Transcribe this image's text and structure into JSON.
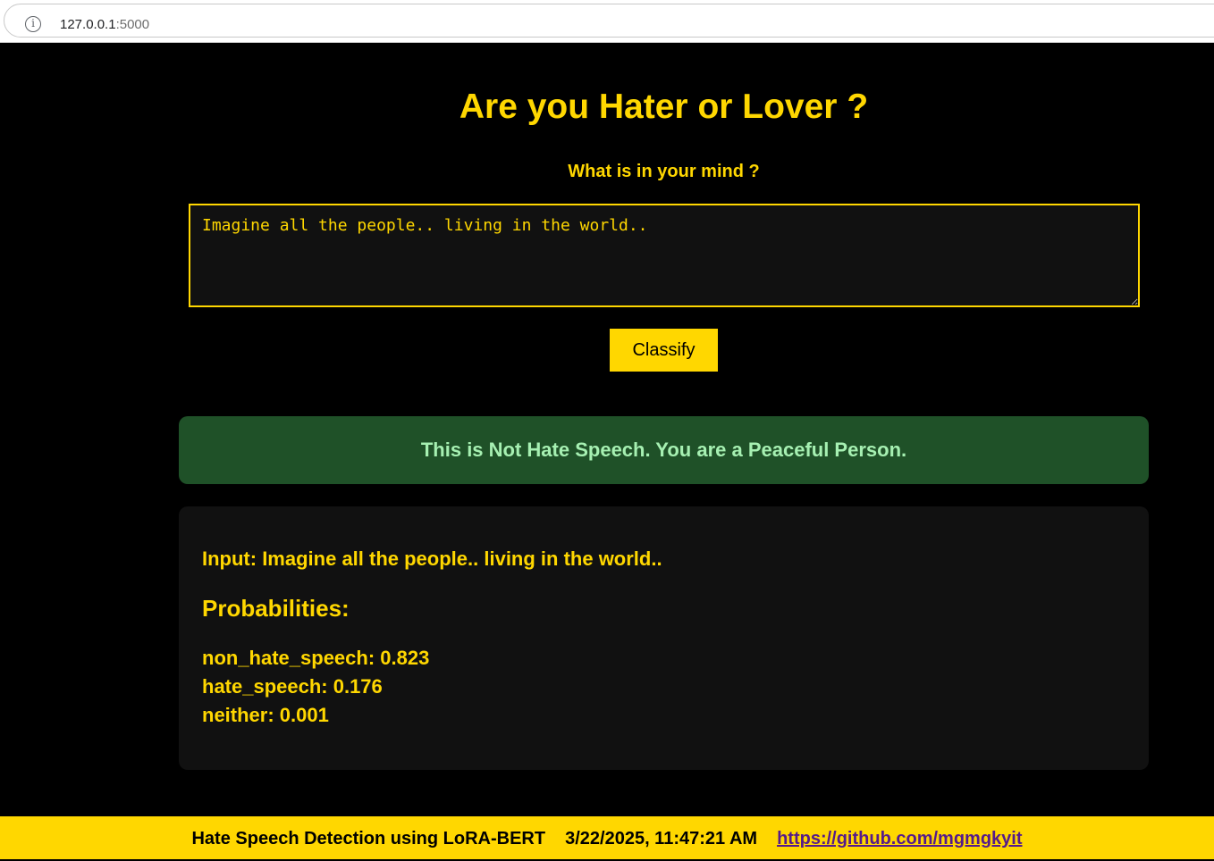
{
  "browser": {
    "url_host": "127.0.0.1",
    "url_port": ":5000",
    "info_icon": "info-icon"
  },
  "header": {
    "title": "Are you Hater or Lover ?",
    "subtitle": "What is in your mind ?"
  },
  "form": {
    "textarea_value": "Imagine all the people.. living in the world..",
    "classify_label": "Classify"
  },
  "result": {
    "message": "This is Not Hate Speech. You are a Peaceful Person.",
    "color": "#1f5128"
  },
  "details": {
    "input_line": "Input: Imagine all the people.. living in the world..",
    "probabilities_heading": "Probabilities:",
    "probabilities": [
      "non_hate_speech: 0.823",
      "hate_speech: 0.176",
      "neither: 0.001"
    ]
  },
  "footer": {
    "app_name": "Hate Speech Detection using LoRA-BERT",
    "timestamp": "3/22/2025, 11:47:21 AM",
    "link_text": "https://github.com/mgmgkyit"
  },
  "colors": {
    "accent": "#ffd700",
    "background": "#000000",
    "card": "#111111",
    "success_text": "#a6f0b2"
  }
}
